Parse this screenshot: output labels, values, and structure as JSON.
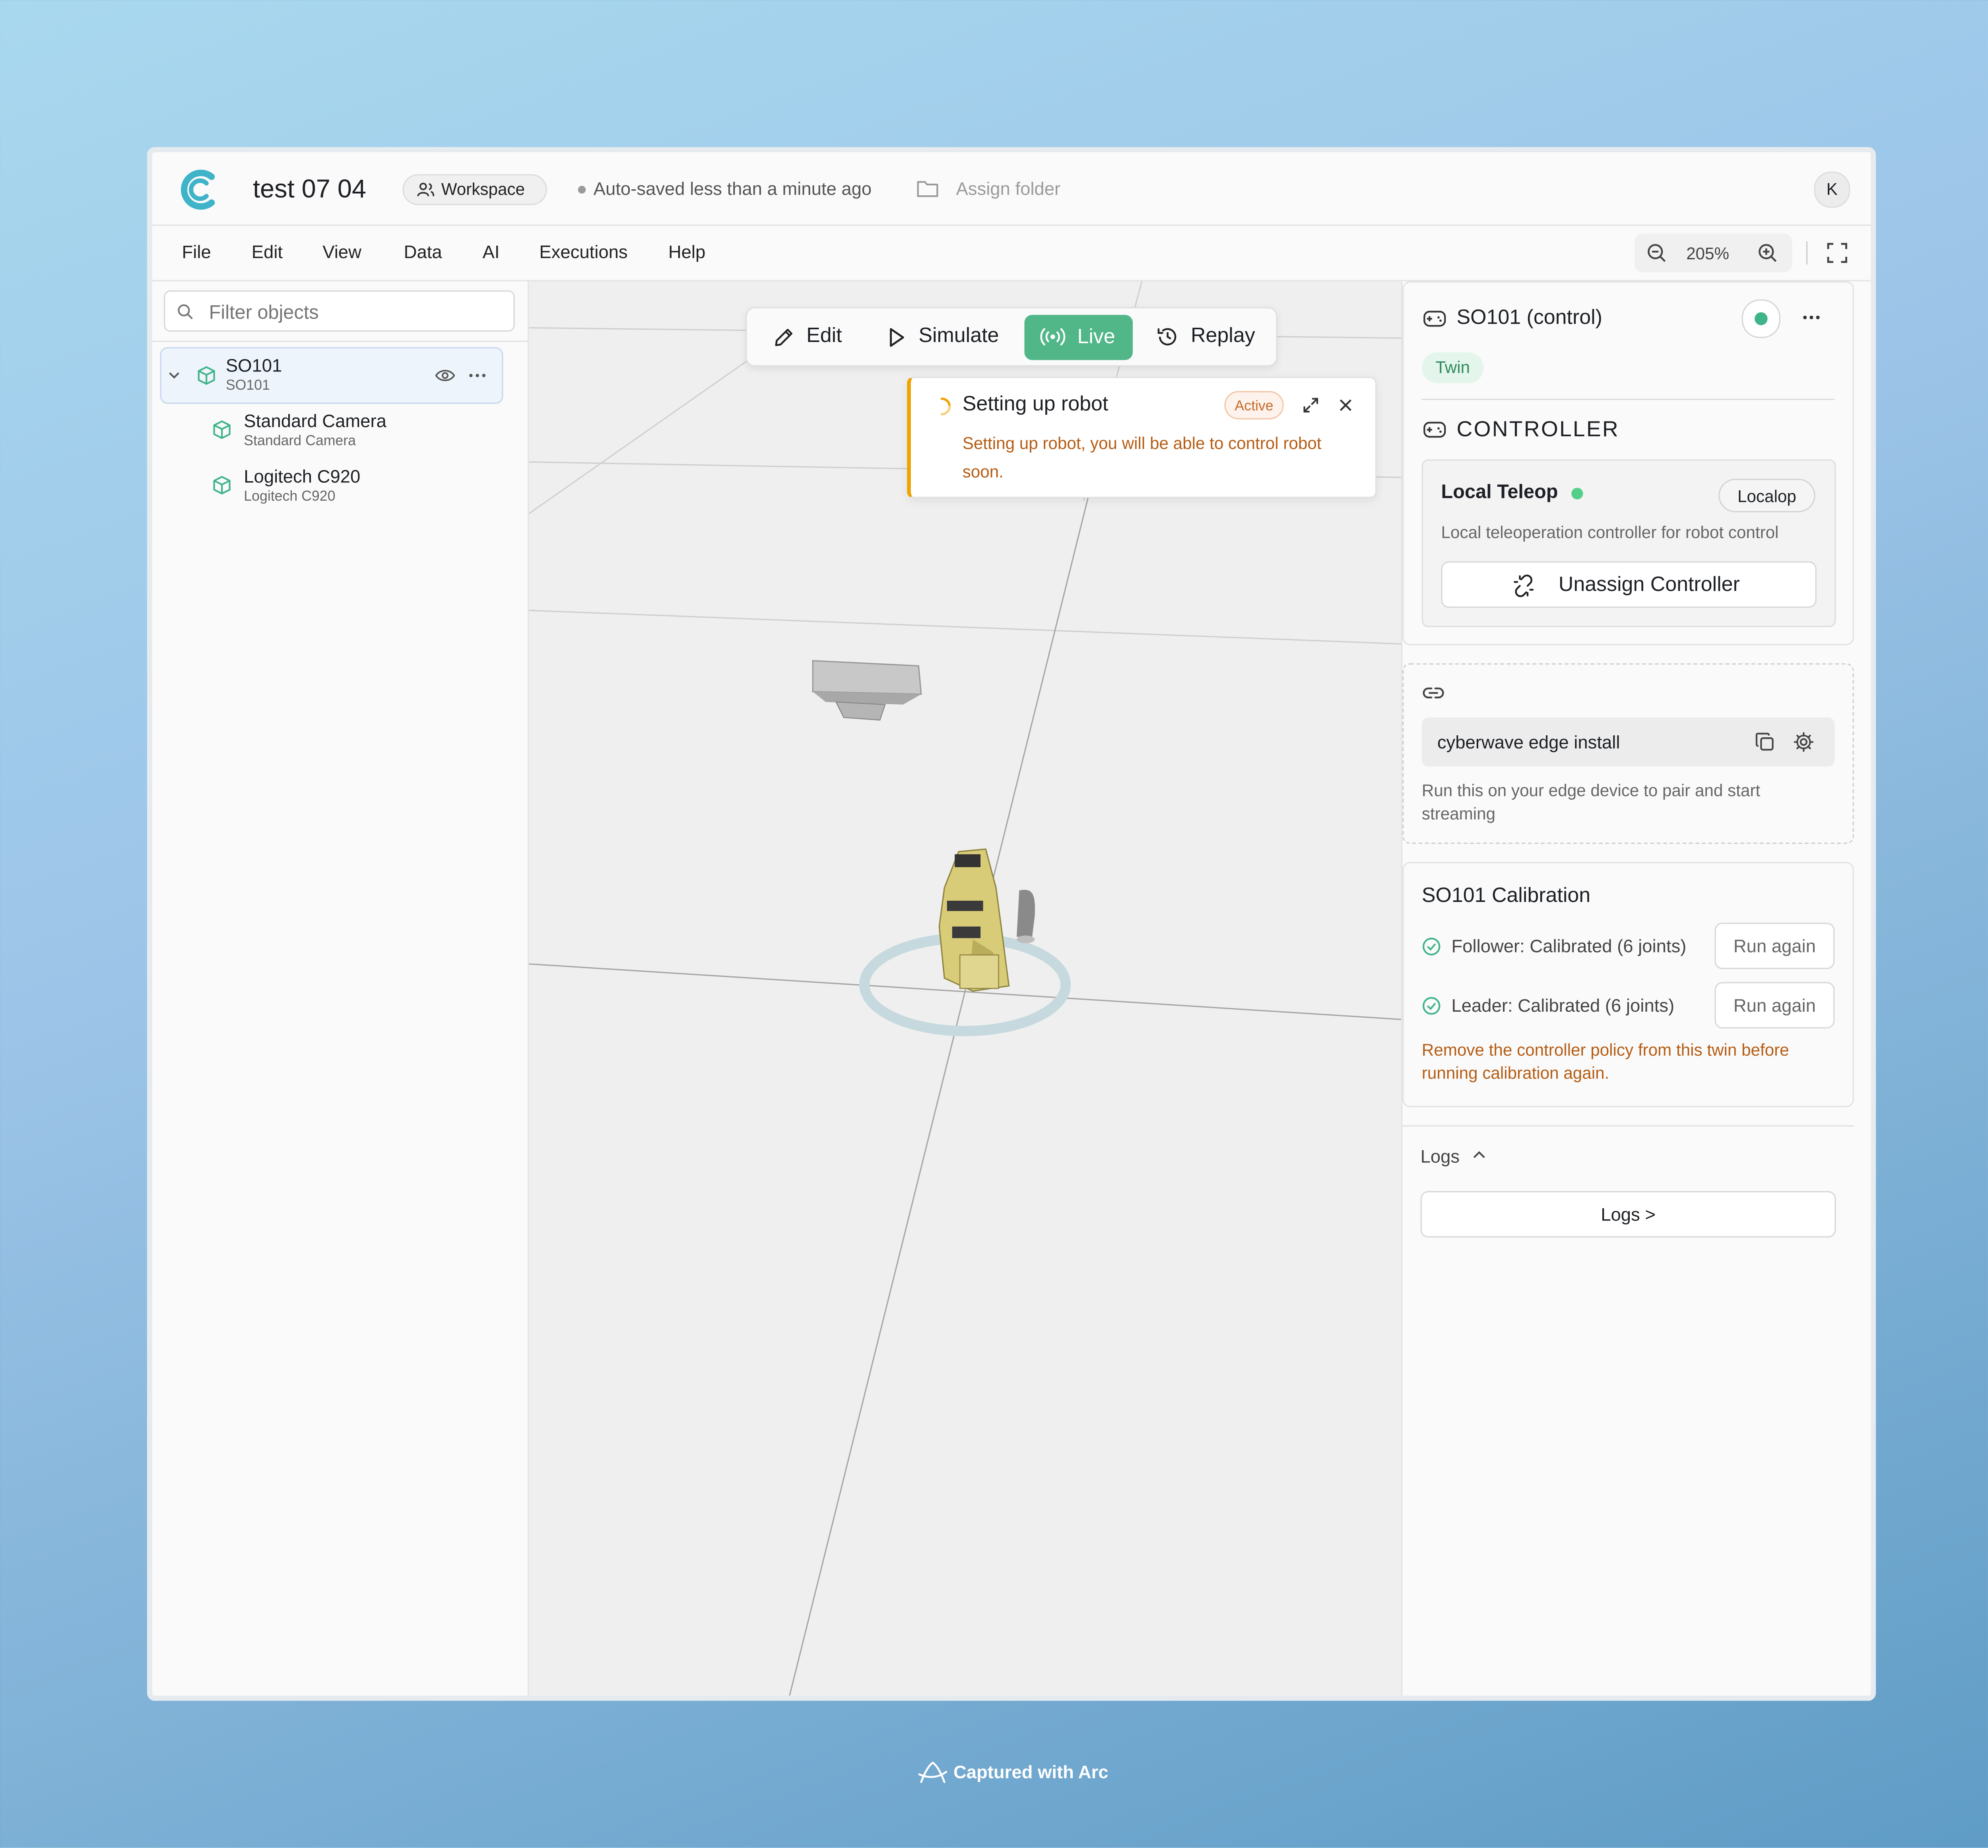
{
  "app": {
    "project_title": "test 07 04",
    "workspace_label": "Workspace",
    "autosave_status": "Auto-saved less than a minute ago",
    "assign_folder_label": "Assign folder",
    "user_avatar": "K"
  },
  "menu": {
    "items": [
      "File",
      "Edit",
      "View",
      "Data",
      "AI",
      "Executions",
      "Help"
    ]
  },
  "zoom": {
    "level": "205%"
  },
  "sidebar": {
    "filter_placeholder": "Filter objects",
    "objects": [
      {
        "name": "SO101",
        "type": "SO101"
      },
      {
        "name": "Standard Camera",
        "type": "Standard Camera"
      },
      {
        "name": "Logitech C920",
        "type": "Logitech C920"
      }
    ]
  },
  "mode_toolbar": {
    "edit": "Edit",
    "simulate": "Simulate",
    "live": "Live",
    "replay": "Replay",
    "active_mode": "Live"
  },
  "notification": {
    "title": "Setting up robot",
    "badge": "Active",
    "message": "Setting up robot, you will be able to control robot soon."
  },
  "inspector": {
    "title": "SO101 (control)",
    "tag": "Twin",
    "controller_heading": "CONTROLLER",
    "controller": {
      "name": "Local Teleop",
      "badge": "Localop",
      "description": "Local teleoperation controller for robot control",
      "unassign_label": "Unassign Controller"
    },
    "edge": {
      "command": "cyberwave edge install",
      "hint": "Run this on your edge device to pair and start streaming"
    },
    "calibration": {
      "title": "SO101 Calibration",
      "follower": "Follower: Calibrated (6 joints)",
      "leader": "Leader: Calibrated (6 joints)",
      "run_again": "Run again",
      "warning": "Remove the controller policy from this twin before running calibration again."
    },
    "logs": {
      "heading": "Logs",
      "button": "Logs >"
    }
  },
  "footer": {
    "capture_label": "Captured with Arc"
  },
  "colors": {
    "accent": "#52b788",
    "logo": "#3fb4c9",
    "warning": "#f0a202",
    "page_bg": "#9cc4e8"
  }
}
